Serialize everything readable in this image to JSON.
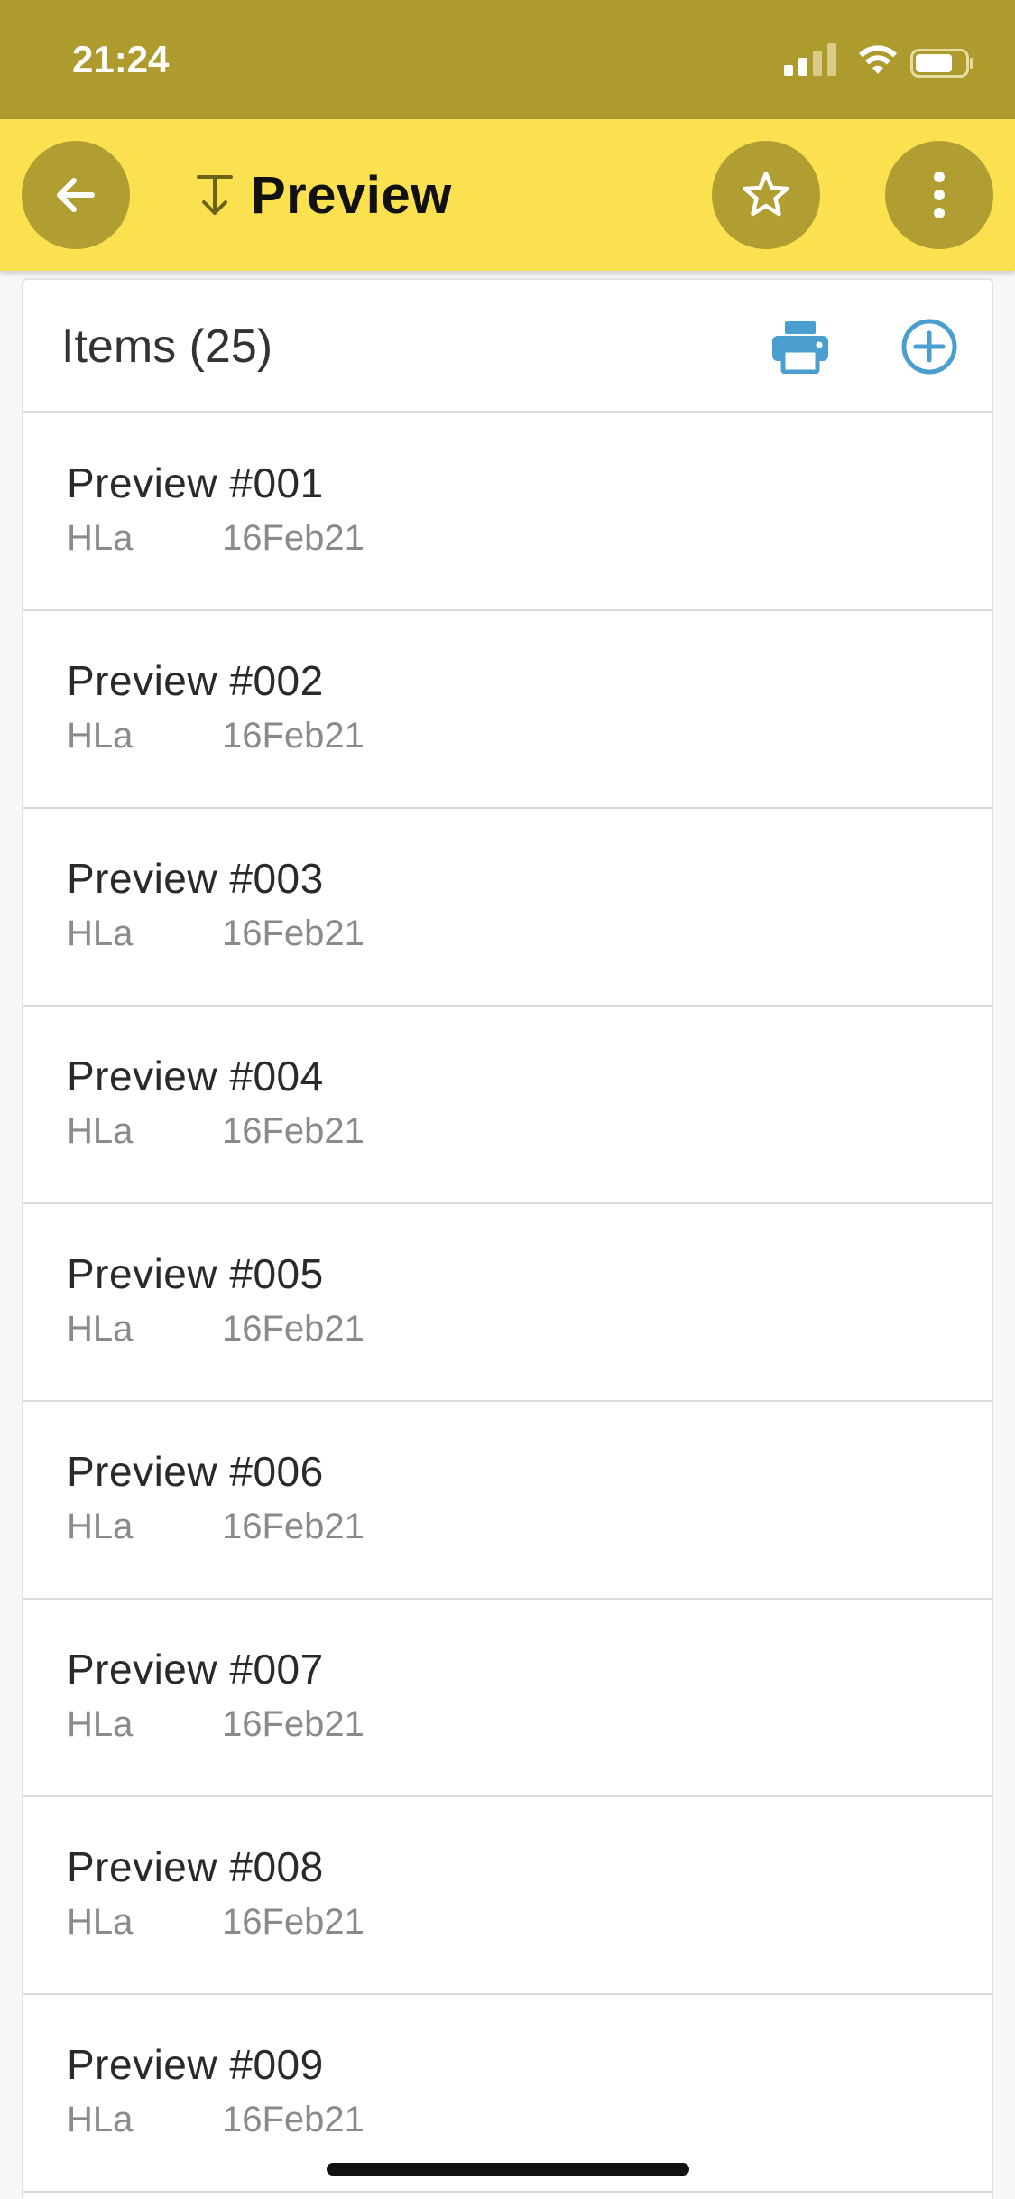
{
  "status_bar": {
    "time": "21:24",
    "icons": [
      "signal-icon",
      "wifi-icon",
      "battery-icon"
    ]
  },
  "app_bar": {
    "title": "Preview",
    "title_icon": "sort-down-icon",
    "back_icon": "arrow-left-icon",
    "star_icon": "star-outline-icon",
    "more_icon": "more-vertical-icon",
    "colors": {
      "status_bar": "#ad9b2e",
      "app_bar": "#fbe14f",
      "circle_button": "#b09e32"
    }
  },
  "list": {
    "header_title": "Items (25)",
    "print_icon": "printer-icon",
    "add_icon": "add-circle-icon",
    "accent_color": "#4a9fd0",
    "items": [
      {
        "title": "Preview #001",
        "author": "HLa",
        "date": "16Feb21"
      },
      {
        "title": "Preview #002",
        "author": "HLa",
        "date": "16Feb21"
      },
      {
        "title": "Preview #003",
        "author": "HLa",
        "date": "16Feb21"
      },
      {
        "title": "Preview #004",
        "author": "HLa",
        "date": "16Feb21"
      },
      {
        "title": "Preview #005",
        "author": "HLa",
        "date": "16Feb21"
      },
      {
        "title": "Preview #006",
        "author": "HLa",
        "date": "16Feb21"
      },
      {
        "title": "Preview #007",
        "author": "HLa",
        "date": "16Feb21"
      },
      {
        "title": "Preview #008",
        "author": "HLa",
        "date": "16Feb21"
      },
      {
        "title": "Preview #009",
        "author": "HLa",
        "date": "16Feb21"
      }
    ]
  }
}
